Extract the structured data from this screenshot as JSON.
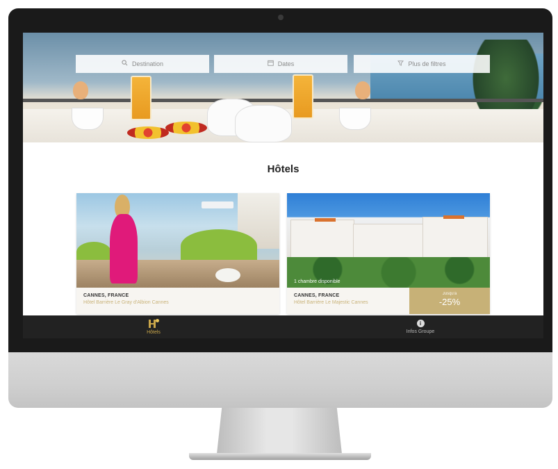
{
  "search": {
    "destination_label": "Destination",
    "dates_label": "Dates",
    "filters_label": "Plus de filtres"
  },
  "page": {
    "title": "Hôtels"
  },
  "hotels": [
    {
      "location": "CANNES, FRANCE",
      "name": "Hôtel Barrière Le Gray d'Albion Cannes"
    },
    {
      "location": "CANNES, FRANCE",
      "name": "Hôtel Barrière Le Majestic Cannes",
      "availability": "1 chambre disponible",
      "promo_label": "Jusqu'à",
      "promo_value": "-25%"
    }
  ],
  "tabbar": {
    "hotels_label": "Hôtels",
    "info_label": "Infos Groupe"
  },
  "colors": {
    "accent_gold": "#c7b177",
    "tabbar_bg": "#222222"
  },
  "icons": {
    "search": "search-icon",
    "calendar": "calendar-icon",
    "filter": "filter-icon",
    "hotels": "hotel-icon",
    "info": "info-icon"
  }
}
